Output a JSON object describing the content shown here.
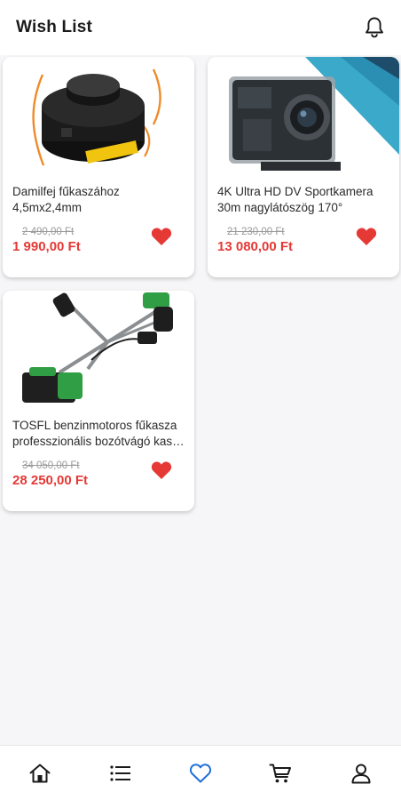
{
  "header": {
    "title": "Wish List",
    "bell_icon": "bell-icon"
  },
  "colors": {
    "price": "#e53935",
    "heart": "#e53935",
    "nav_active": "#1e6fd9"
  },
  "products": [
    {
      "name_line1": "Damilfej fűkaszához",
      "name_line2": "4,5mx2,4mm",
      "old_price": "2 490,00 Ft",
      "price": "1 990,00 Ft",
      "favorite": true
    },
    {
      "name_line1": "4K Ultra HD DV Sportkamera",
      "name_line2": "30m nagylátószög 170°",
      "old_price": "21 230,00 Ft",
      "price": "13 080,00 Ft",
      "favorite": true
    },
    {
      "name_line1": "TOSFL benzinmotoros fűkasza",
      "name_line2": "professzionális bozótvágó kasz...",
      "old_price": "34 050,00 Ft",
      "price": "28 250,00 Ft",
      "favorite": true
    }
  ],
  "bottom_nav": {
    "items": [
      "home-icon",
      "list-icon",
      "heart-icon",
      "cart-icon",
      "profile-icon"
    ],
    "active": "heart-icon"
  }
}
